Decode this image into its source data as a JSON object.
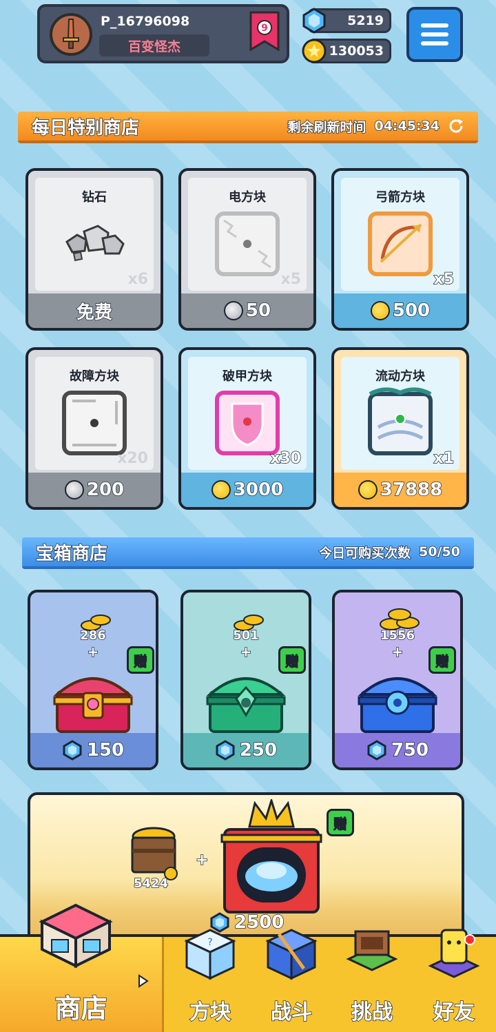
{
  "header": {
    "player_id": "P_16796098",
    "player_title": "百变怪杰",
    "rank_level": "9",
    "gems": "5219",
    "coins": "130053"
  },
  "daily_shop": {
    "title": "每日特别商店",
    "refresh_label": "剩余刷新时间",
    "refresh_time": "04:45:34",
    "items": [
      {
        "name": "钻石",
        "qty": "x6",
        "price": "免费",
        "currency": "none",
        "icon": "rocks-icon"
      },
      {
        "name": "电方块",
        "qty": "x5",
        "price": "50",
        "currency": "silver",
        "icon": "electric-block-icon"
      },
      {
        "name": "弓箭方块",
        "qty": "x5",
        "price": "500",
        "currency": "gold",
        "icon": "bow-block-icon"
      },
      {
        "name": "故障方块",
        "qty": "x20",
        "price": "200",
        "currency": "silver",
        "icon": "glitch-block-icon"
      },
      {
        "name": "破甲方块",
        "qty": "x30",
        "price": "3000",
        "currency": "gold",
        "icon": "armor-break-block-icon"
      },
      {
        "name": "流动方块",
        "qty": "x1",
        "price": "37888",
        "currency": "gold",
        "icon": "flow-block-icon"
      }
    ]
  },
  "chest_shop": {
    "title": "宝箱商店",
    "purchases_label": "今日可购买次数",
    "purchases_value": "50/50",
    "gift_label": "赠",
    "plus": "+",
    "chests": [
      {
        "coins": "286",
        "price": "150",
        "color": "#a8c2ee",
        "price_bg": "#6a8ed8"
      },
      {
        "coins": "501",
        "price": "250",
        "color": "#a9dcdc",
        "price_bg": "#5db7b7"
      },
      {
        "coins": "1556",
        "price": "750",
        "color": "#c3b6f0",
        "price_bg": "#8a7ae0"
      }
    ],
    "big_offer": {
      "coins": "5424",
      "price": "2500"
    }
  },
  "nav": {
    "shop": "商店",
    "blocks": "方块",
    "battle": "战斗",
    "challenge": "挑战",
    "friends": "好友"
  }
}
